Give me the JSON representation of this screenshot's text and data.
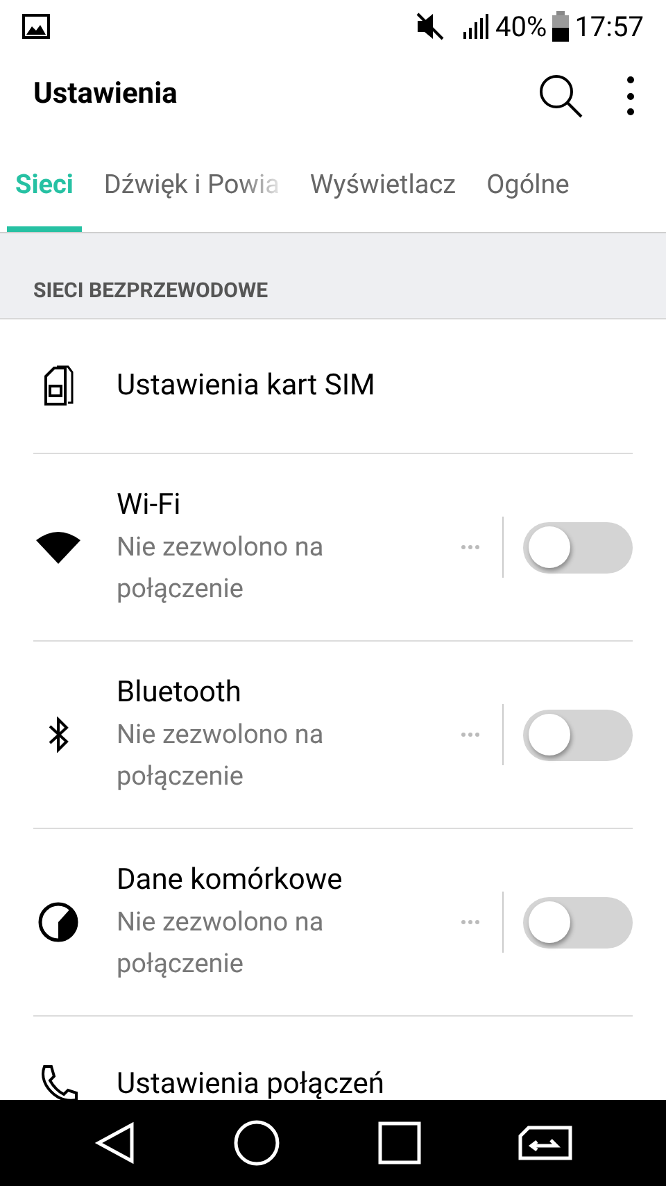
{
  "status_bar": {
    "battery": "40%",
    "time": "17:57"
  },
  "app_bar": {
    "title": "Ustawienia"
  },
  "tabs": [
    {
      "label": "Sieci",
      "selected": true
    },
    {
      "label": "Dźwięk i Powia",
      "selected": false
    },
    {
      "label": "Wyświetlacz",
      "selected": false
    },
    {
      "label": "Ogólne",
      "selected": false
    }
  ],
  "section": {
    "title": "SIECI BEZPRZEWODOWE"
  },
  "rows": [
    {
      "kind": "link",
      "title": "Ustawienia kart SIM"
    },
    {
      "kind": "toggle",
      "title": "Wi-Fi",
      "subtitle": "Nie zezwolono na połączenie",
      "on": false
    },
    {
      "kind": "toggle",
      "title": "Bluetooth",
      "subtitle": "Nie zezwolono na połączenie",
      "on": false
    },
    {
      "kind": "toggle",
      "title": "Dane komórkowe",
      "subtitle": "Nie zezwolono na połączenie",
      "on": false
    },
    {
      "kind": "link",
      "title": "Ustawienia połączeń"
    }
  ]
}
